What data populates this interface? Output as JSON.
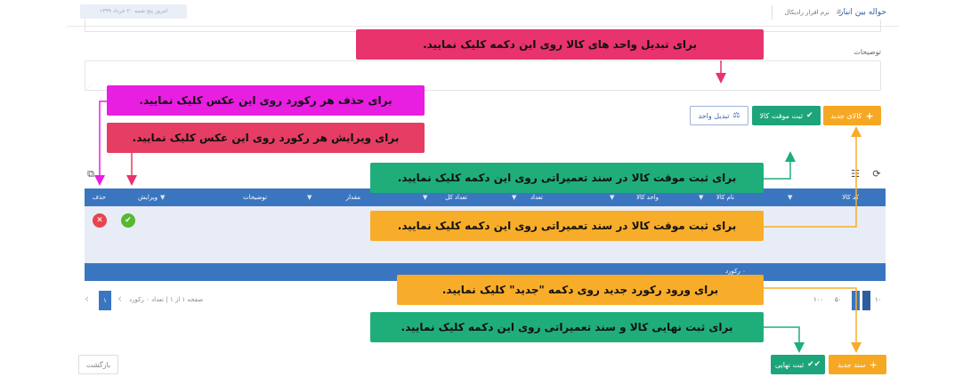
{
  "header": {
    "title": "حواله بین انبار",
    "separator": "#",
    "subtitle": "نرم افزار رادیکال",
    "date_pill": "امروز پنج شنبه ۲۰ خرداد ۱۳۹۹"
  },
  "description": {
    "label": "توضیحات"
  },
  "toolbar": {
    "new_item_label": "کالای جدید",
    "temp_save_label": "ثبت موقت کالا",
    "unit_convert_label": "تبدیل واحد"
  },
  "table": {
    "columns": [
      "کد کالا",
      "نام کالا",
      "واحد کالا",
      "تعداد",
      "تعداد کل",
      "مقدار",
      "توضیحات",
      "ویرایش",
      "حذف"
    ],
    "footer_text": "۰ رکورد"
  },
  "pager": {
    "info": "صفحه ۱ از ۱ | تعداد ۰ رکورد",
    "current_page": "۱",
    "page_sizes": [
      "۱۰",
      "۵۰",
      "۱۰۰"
    ]
  },
  "footer": {
    "new_doc_label": "سند جدید",
    "final_save_label": "ثبت نهایی",
    "back_label": "بازگشت"
  },
  "callouts": {
    "unit_convert": "برای تبدیل واحد های کالا روی این دکمه کلیک نمایید.",
    "delete": "برای حذف هر رکورد روی این عکس کلیک نمایید.",
    "edit": "برای ویرایش هر رکورد روی این عکس کلیک نمایید.",
    "temp_save_1": "برای ثبت موقت کالا در سند تعمیراتی روی این دکمه کلیک نمایید.",
    "temp_save_2": "برای ثبت موقت کالا در سند تعمیراتی روی این دکمه کلیک نمایید.",
    "new_record": "برای ورود رکورد جدید روی دکمه \"جدید\" کلیک نمایید.",
    "final_save": "برای ثبت نهایی کالا و سند تعمیراتی روی این دکمه کلیک نمایید."
  },
  "colors": {
    "header_blue": "#3a76c0",
    "orange": "#f7a823",
    "green": "#1ea47a",
    "pink": "#e8336d",
    "magenta": "#e81ee0",
    "row_bg": "#e7ecf7"
  },
  "icons": [
    "plus-icon",
    "check-icon",
    "unit-convert-icon",
    "refresh-icon",
    "columns-icon",
    "export-icon",
    "delete-icon",
    "edit-icon",
    "chevron-left-icon",
    "chevron-right-icon",
    "double-check-icon"
  ]
}
